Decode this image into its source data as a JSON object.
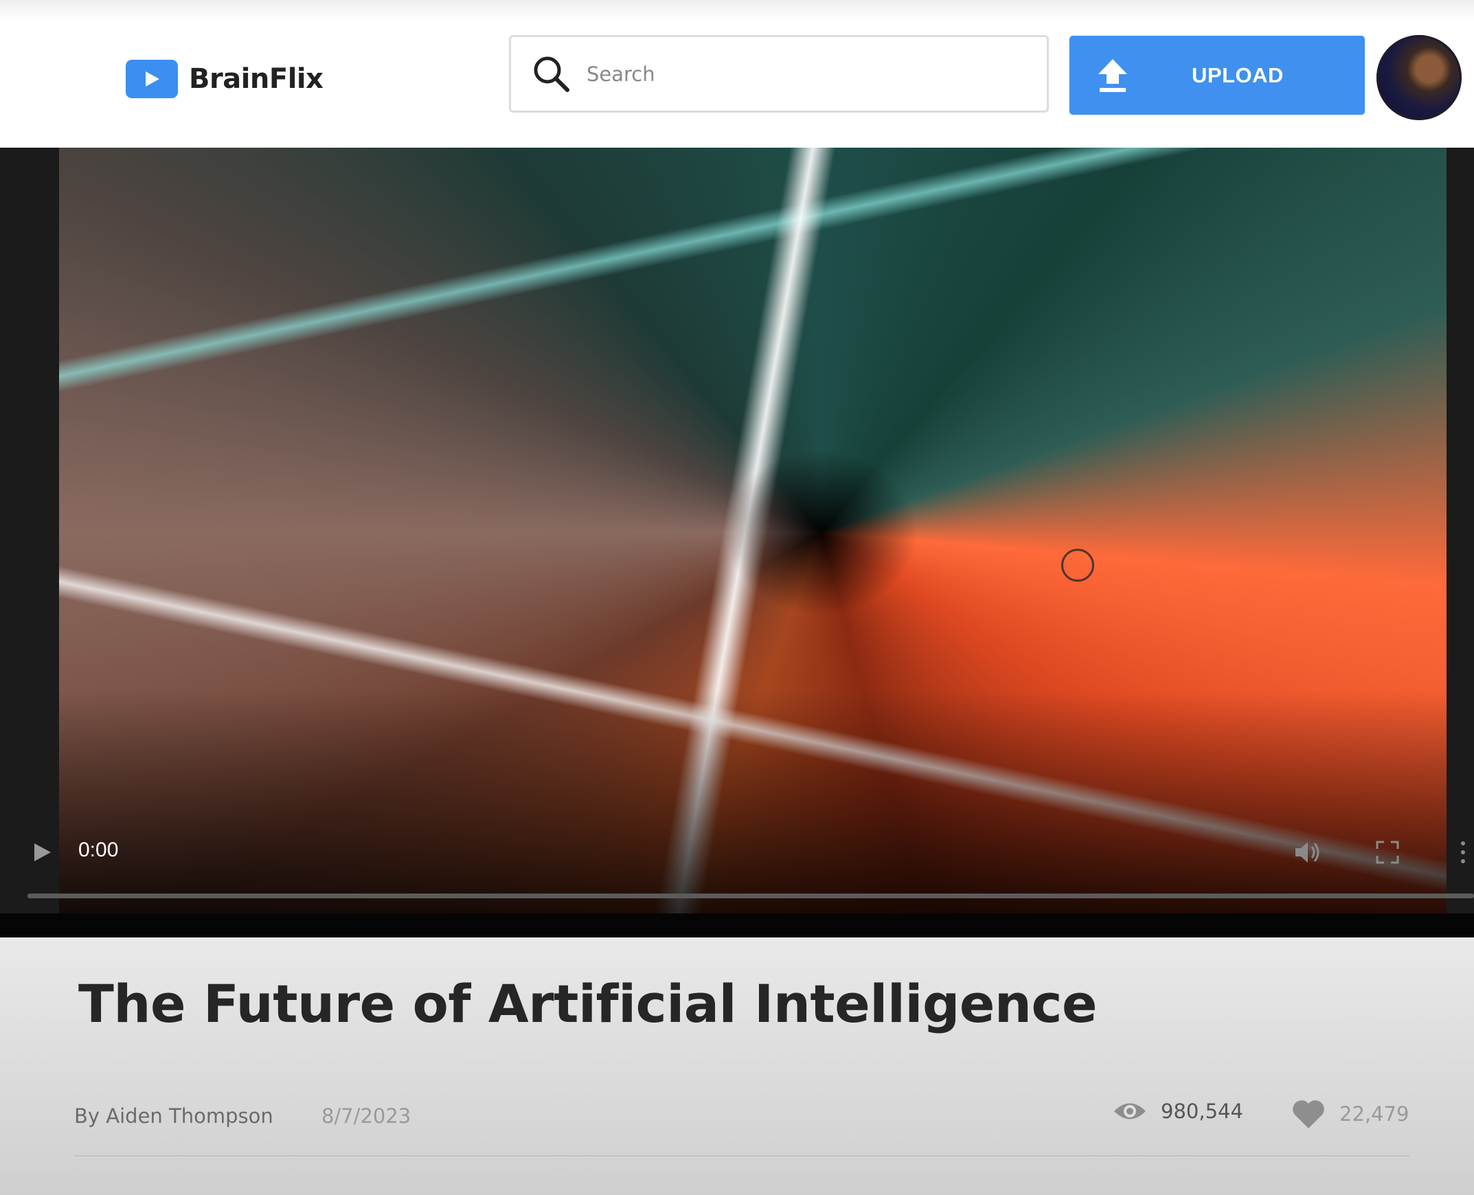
{
  "app": {
    "name": "BrainFlix"
  },
  "header": {
    "search_placeholder": "Search",
    "upload_label": "UPLOAD"
  },
  "player": {
    "current_time": "0:00",
    "progress": 0
  },
  "video": {
    "title": "The Future of Artificial Intelligence",
    "author": "By Aiden Thompson",
    "date": "8/7/2023",
    "views": "980,544",
    "likes": "22,479"
  },
  "colors": {
    "brand": "#3f90ef",
    "title_text": "#262626",
    "meta_text": "#6b6b6b"
  },
  "icons": {
    "logo": "play-logo-icon",
    "search": "search-icon",
    "upload": "upload-icon",
    "play": "play-icon",
    "volume": "volume-icon",
    "fullscreen": "fullscreen-icon",
    "more": "more-vertical-icon",
    "views": "eye-icon",
    "likes": "heart-icon"
  }
}
